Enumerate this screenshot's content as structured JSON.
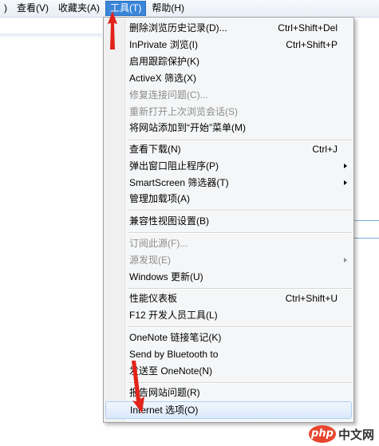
{
  "menubar": {
    "items": [
      {
        "label": ")"
      },
      {
        "label": "查看(V)"
      },
      {
        "label": "收藏夹(A)"
      },
      {
        "label": "工具(T)",
        "active": true
      },
      {
        "label": "帮助(H)"
      }
    ]
  },
  "tools_menu": {
    "items": [
      {
        "label": "删除浏览历史记录(D)...",
        "shortcut": "Ctrl+Shift+Del",
        "disabled": false
      },
      {
        "label": "InPrivate 浏览(I)",
        "shortcut": "Ctrl+Shift+P",
        "disabled": false
      },
      {
        "label": "启用跟踪保护(K)",
        "shortcut": "",
        "disabled": false
      },
      {
        "label": "ActiveX 筛选(X)",
        "shortcut": "",
        "disabled": false
      },
      {
        "label": "修复连接问题(C)...",
        "shortcut": "",
        "disabled": true
      },
      {
        "label": "重新打开上次浏览会话(S)",
        "shortcut": "",
        "disabled": true
      },
      {
        "label": "将网站添加到“开始”菜单(M)",
        "shortcut": "",
        "disabled": false
      },
      {
        "label": "查看下载(N)",
        "shortcut": "Ctrl+J",
        "disabled": false
      },
      {
        "label": "弹出窗口阻止程序(P)",
        "shortcut": "",
        "submenu": true,
        "disabled": false
      },
      {
        "label": "SmartScreen 筛选器(T)",
        "shortcut": "",
        "submenu": true,
        "disabled": false
      },
      {
        "label": "管理加载项(A)",
        "shortcut": "",
        "disabled": false
      },
      {
        "label": "兼容性视图设置(B)",
        "shortcut": "",
        "disabled": false
      },
      {
        "label": "订阅此源(F)...",
        "shortcut": "",
        "disabled": true
      },
      {
        "label": "源发现(E)",
        "shortcut": "",
        "submenu": true,
        "disabled": true
      },
      {
        "label": "Windows 更新(U)",
        "shortcut": "",
        "disabled": false
      },
      {
        "label": "性能仪表板",
        "shortcut": "Ctrl+Shift+U",
        "disabled": false
      },
      {
        "label": "F12 开发人员工具(L)",
        "shortcut": "",
        "disabled": false
      },
      {
        "label": "OneNote 链接笔记(K)",
        "shortcut": "",
        "disabled": false
      },
      {
        "label": "Send by Bluetooth to",
        "shortcut": "",
        "disabled": false
      },
      {
        "label": "发送至 OneNote(N)",
        "shortcut": "",
        "disabled": false
      },
      {
        "label": "报告网站问题(R)",
        "shortcut": "",
        "disabled": false
      },
      {
        "label": "Internet 选项(O)",
        "shortcut": "",
        "disabled": false,
        "highlighted": true
      }
    ]
  },
  "watermark": {
    "logo": "php",
    "text": "中文网"
  },
  "colors": {
    "menubar_active": "#3a86d9",
    "annotation_arrow": "#e2231a",
    "highlight_border": "#aecff7"
  }
}
